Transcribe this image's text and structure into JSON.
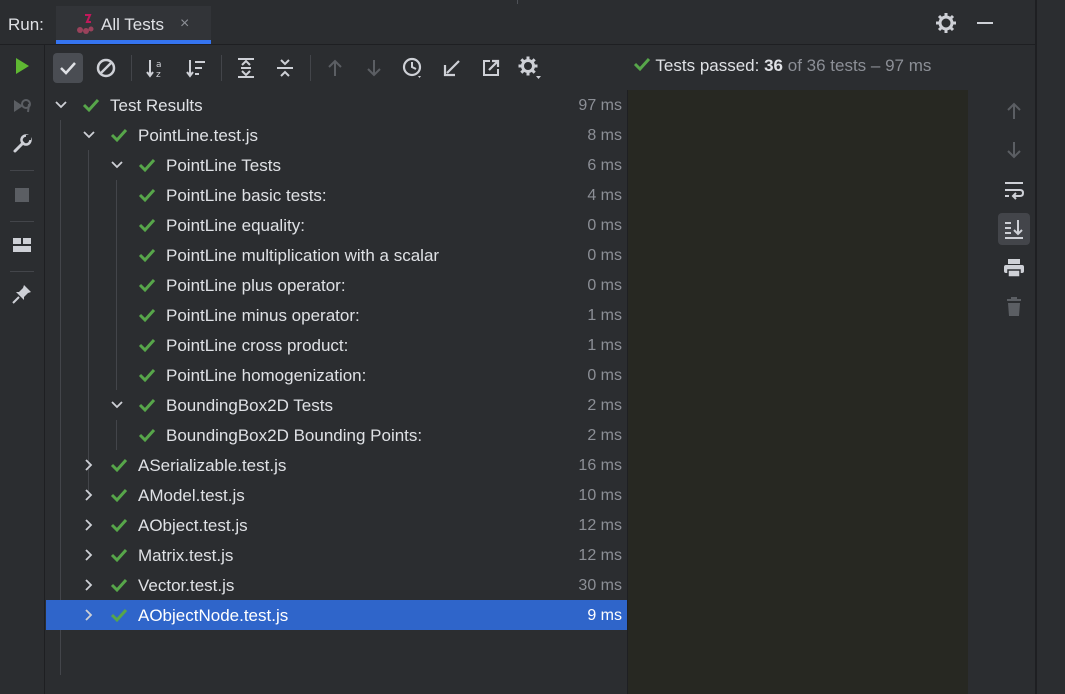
{
  "run_label": "Run:",
  "tab": {
    "label": "All Tests",
    "close": "×"
  },
  "status": {
    "prefix": "Tests passed: ",
    "passed": "36",
    "suffix": " of 36 tests – 97 ms"
  },
  "colors": {
    "accent": "#3574f0",
    "pass": "#57a64a",
    "selected": "#2f65ca",
    "run": "#5fb832"
  },
  "tree": [
    {
      "label": "Test Results",
      "duration": "97 ms",
      "depth": 0,
      "expanded": true
    },
    {
      "label": "PointLine.test.js",
      "duration": "8 ms",
      "depth": 1,
      "expanded": true
    },
    {
      "label": "PointLine Tests",
      "duration": "6 ms",
      "depth": 2,
      "expanded": true
    },
    {
      "label": "PointLine basic tests:",
      "duration": "4 ms",
      "depth": 3
    },
    {
      "label": "PointLine equality:",
      "duration": "0 ms",
      "depth": 3
    },
    {
      "label": "PointLine multiplication with a scalar",
      "duration": "0 ms",
      "depth": 3
    },
    {
      "label": "PointLine plus operator:",
      "duration": "0 ms",
      "depth": 3
    },
    {
      "label": "PointLine minus operator:",
      "duration": "1 ms",
      "depth": 3
    },
    {
      "label": "PointLine cross product:",
      "duration": "1 ms",
      "depth": 3
    },
    {
      "label": "PointLine homogenization:",
      "duration": "0 ms",
      "depth": 3
    },
    {
      "label": "BoundingBox2D Tests",
      "duration": "2 ms",
      "depth": 2,
      "expanded": true
    },
    {
      "label": "BoundingBox2D Bounding Points:",
      "duration": "2 ms",
      "depth": 3
    },
    {
      "label": "ASerializable.test.js",
      "duration": "16 ms",
      "depth": 1,
      "expanded": false
    },
    {
      "label": "AModel.test.js",
      "duration": "10 ms",
      "depth": 1,
      "expanded": false
    },
    {
      "label": "AObject.test.js",
      "duration": "12 ms",
      "depth": 1,
      "expanded": false
    },
    {
      "label": "Matrix.test.js",
      "duration": "12 ms",
      "depth": 1,
      "expanded": false
    },
    {
      "label": "Vector.test.js",
      "duration": "30 ms",
      "depth": 1,
      "expanded": false
    },
    {
      "label": "AObjectNode.test.js",
      "duration": "9 ms",
      "depth": 1,
      "expanded": false,
      "selected": true
    }
  ]
}
